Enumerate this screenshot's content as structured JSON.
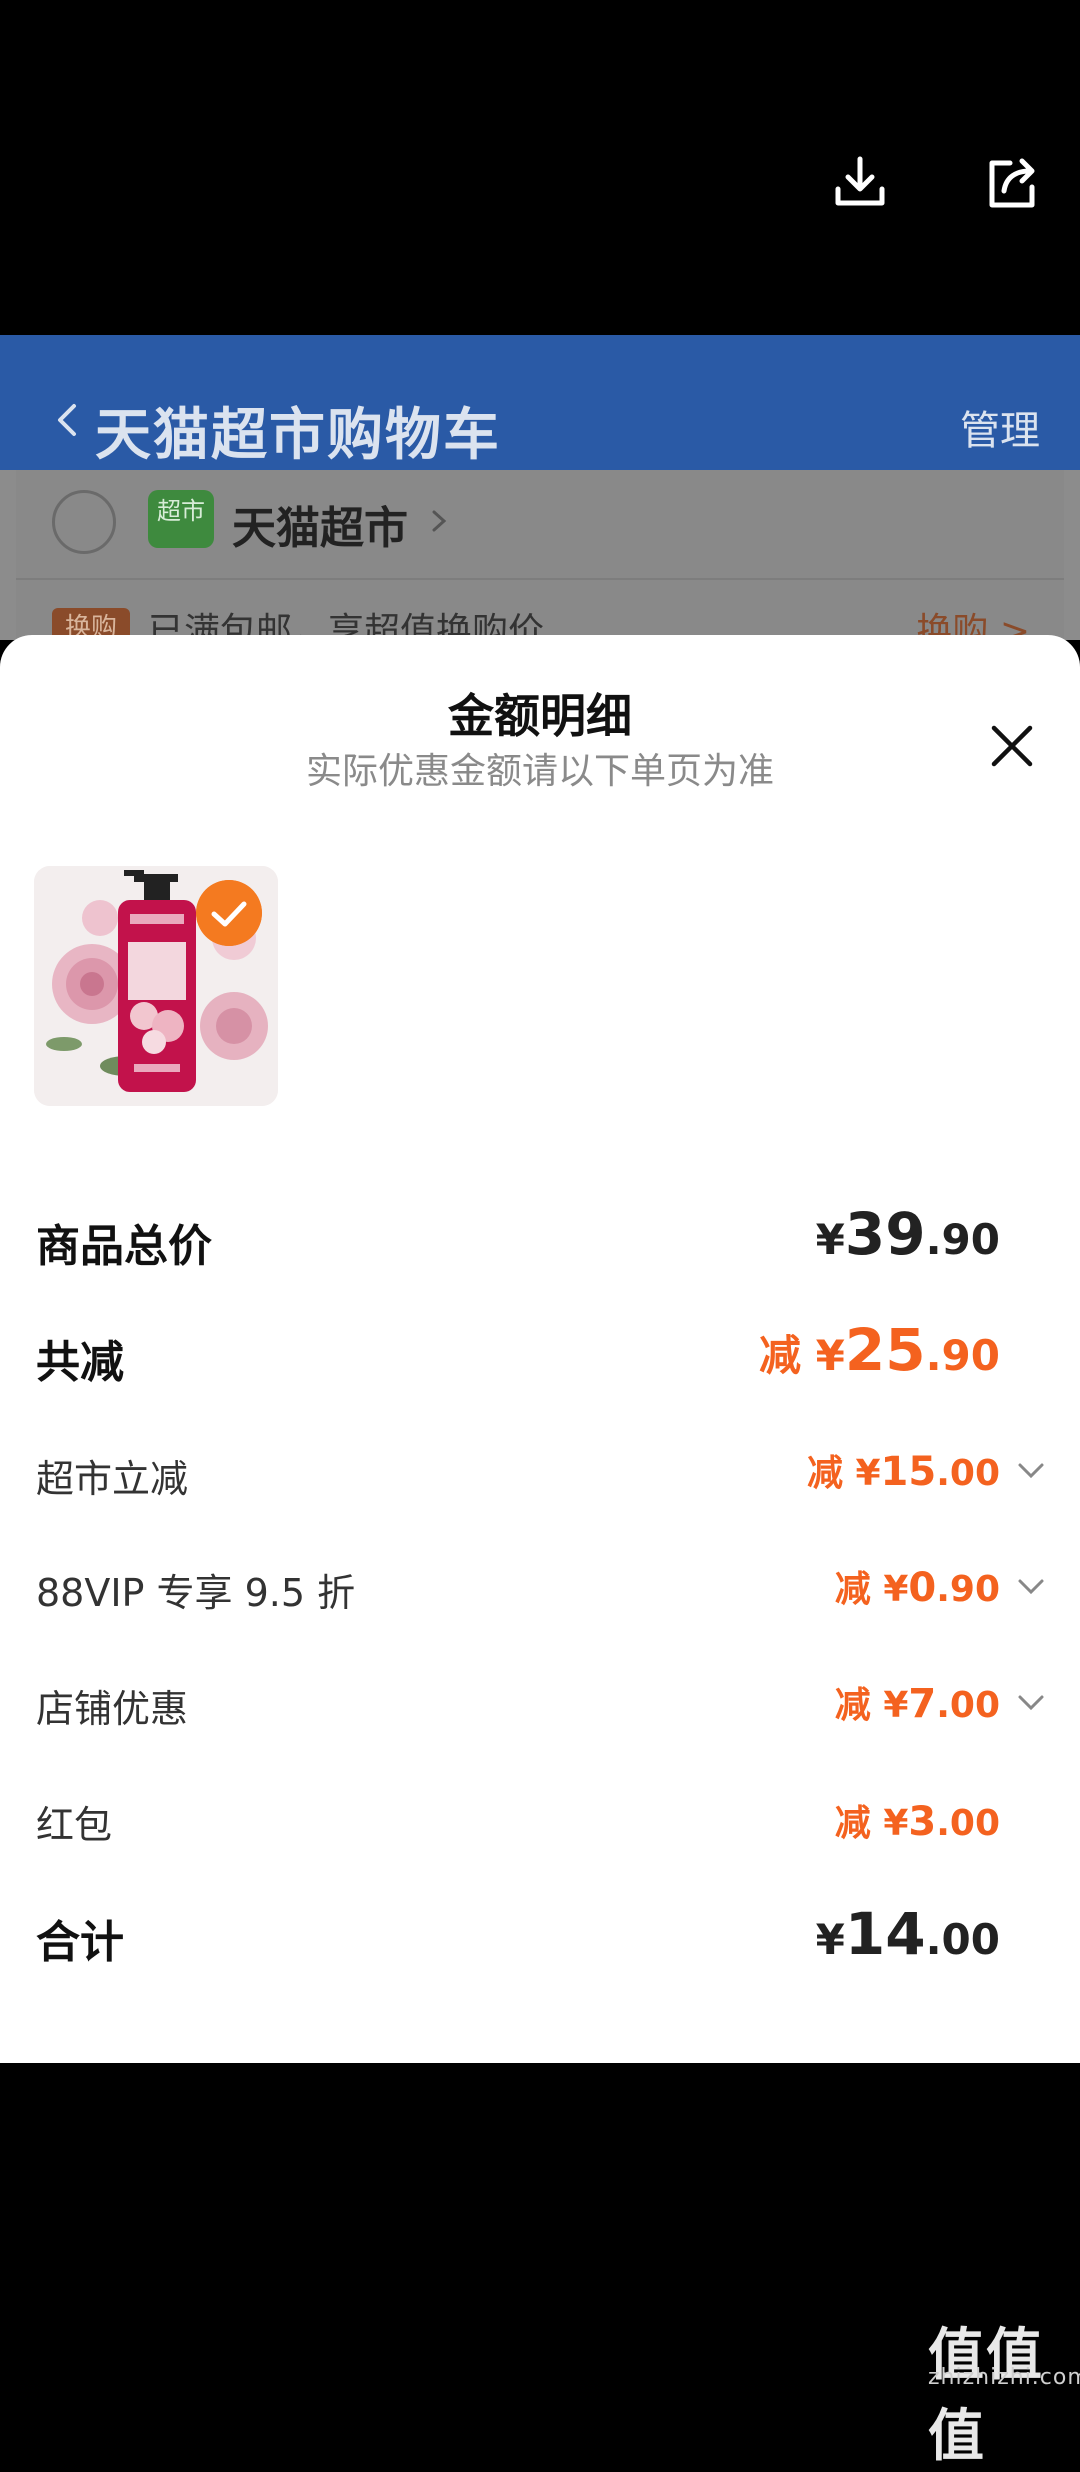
{
  "top_actions": {
    "download_icon": "download-icon",
    "share_icon": "share-icon"
  },
  "cart": {
    "title": "天猫超市购物车",
    "manage_label": "管理",
    "store_logo_text": "超市",
    "store_name": "天猫超市",
    "swap_tag": "换购",
    "swap_text": "已满包邮，享超值换购价",
    "swap_action": "换购 >"
  },
  "sheet": {
    "title": "金额明细",
    "subtitle": "实际优惠金额请以下单页为准",
    "product": {
      "image": "product-image-rose-shampoo",
      "selected": true
    },
    "rows": {
      "total_price": {
        "label": "商品总价",
        "currency": "¥",
        "integer": "39",
        "decimal": ".90"
      },
      "total_discount": {
        "label": "共减",
        "prefix": "减 ¥",
        "integer": "25",
        "decimal": ".90"
      },
      "supermarket": {
        "label": "超市立减",
        "prefix": "减 ¥",
        "integer": "15",
        "decimal": ".00"
      },
      "vip": {
        "label": "88VIP 专享 9.5 折",
        "prefix": "减 ¥",
        "integer": "0",
        "decimal": ".90"
      },
      "store": {
        "label": "店铺优惠",
        "prefix": "减 ¥",
        "integer": "7",
        "decimal": ".00"
      },
      "redpacket": {
        "label": "红包",
        "prefix": "减 ¥",
        "integer": "3",
        "decimal": ".00"
      },
      "sum": {
        "label": "合计",
        "currency": "¥",
        "integer": "14",
        "decimal": ".00"
      }
    }
  },
  "watermark": {
    "text": "值值值",
    "url": "zhizhizhi.com"
  },
  "colors": {
    "accent_orange": "#f4621f",
    "header_blue": "#2a5aa6"
  }
}
